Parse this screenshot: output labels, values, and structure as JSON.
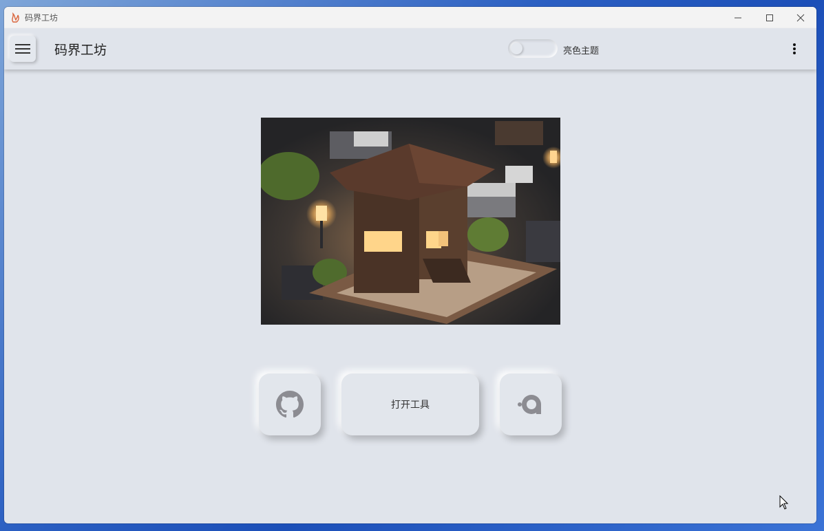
{
  "window": {
    "title": "码界工坊",
    "controls": {
      "minimize": "minimize-icon",
      "maximize": "maximize-icon",
      "close": "close-icon"
    }
  },
  "appbar": {
    "menu_icon": "hamburger-menu-icon",
    "title": "码界工坊",
    "theme_toggle": {
      "state": "off",
      "label": "亮色主题"
    },
    "more_icon": "more-vertical-icon"
  },
  "main": {
    "hero_image": "isometric-voxel-house-illustration",
    "buttons": {
      "github_icon": "github-icon",
      "open_tool_label": "打开工具",
      "other_icon": "gitee-style-icon"
    }
  },
  "colors": {
    "background": "#e0e4eb",
    "titlebar": "#f3f3f3",
    "accent_icon": "#d9643c"
  }
}
